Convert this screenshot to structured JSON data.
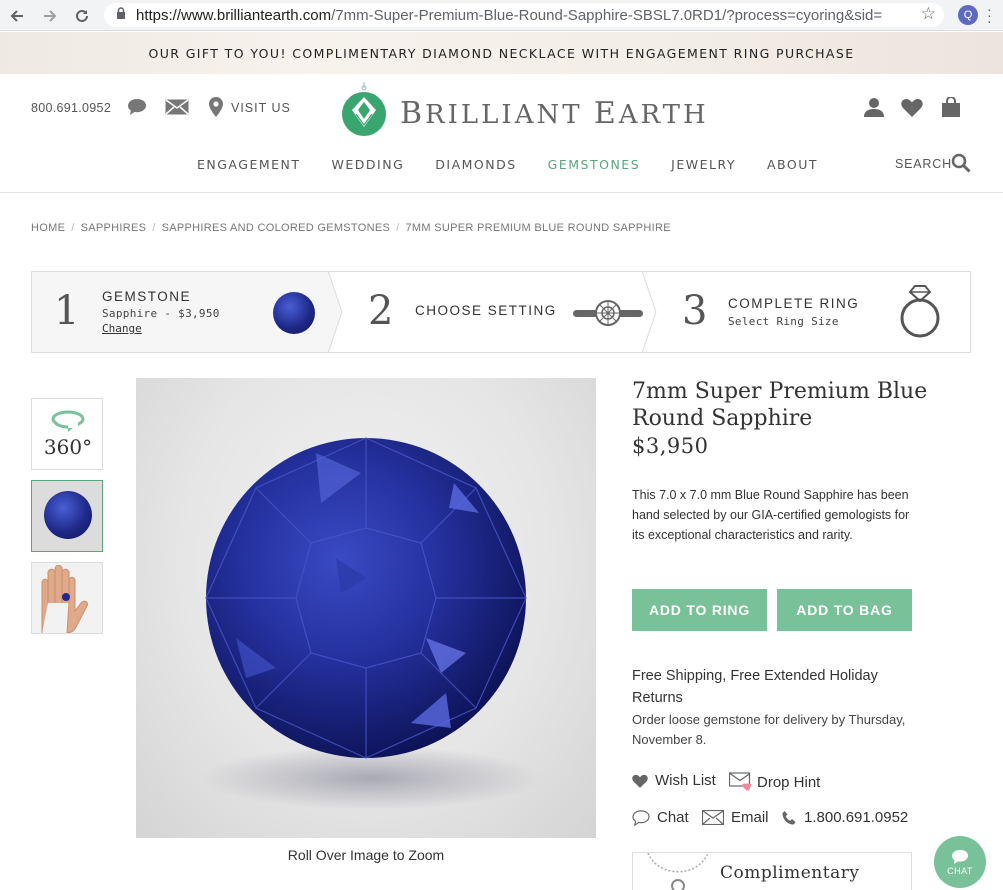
{
  "browser": {
    "url_host": "https://www.brilliantearth.com",
    "url_path": "/7mm-Super-Premium-Blue-Round-Sapphire-SBSL7.0RD1/?process=cyoring&sid=",
    "profile_initial": "Q"
  },
  "promo_banner": "OUR GIFT TO YOU! COMPLIMENTARY DIAMOND NECKLACE WITH ENGAGEMENT RING PURCHASE",
  "header": {
    "phone": "800.691.0952",
    "visit_label": "VISIT US",
    "logo_word1_initial": "B",
    "logo_word1_rest": "RILLIANT",
    "logo_word2_initial": "E",
    "logo_word2_rest": "ARTH",
    "search_label": "SEARCH"
  },
  "nav": {
    "items": [
      "ENGAGEMENT",
      "WEDDING",
      "DIAMONDS",
      "GEMSTONES",
      "JEWELRY",
      "ABOUT"
    ],
    "active": "GEMSTONES"
  },
  "breadcrumb": [
    "HOME",
    "SAPPHIRES",
    "SAPPHIRES AND COLORED GEMSTONES",
    "7MM SUPER PREMIUM BLUE ROUND SAPPHIRE"
  ],
  "steps": [
    {
      "num": "1",
      "title": "GEMSTONE",
      "sub": "Sapphire - $3,950",
      "link": "Change"
    },
    {
      "num": "2",
      "title": "CHOOSE SETTING"
    },
    {
      "num": "3",
      "title": "COMPLETE RING",
      "sub": "Select Ring Size"
    }
  ],
  "thumbs": {
    "view360_label": "360°"
  },
  "product": {
    "title": "7mm Super Premium Blue Round Sapphire",
    "price": "$3,950",
    "description": "This 7.0 x 7.0 mm Blue Round Sapphire has been hand selected by our GIA-certified gemologists for its exceptional characteristics and rarity.",
    "add_to_ring": "ADD TO RING",
    "add_to_bag": "ADD TO BAG",
    "shipping_title": "Free Shipping, Free Extended Holiday Returns",
    "shipping_sub": "Order loose gemstone for delivery by Thursday, November 8.",
    "wish_list": "Wish List",
    "drop_hint": "Drop Hint",
    "chat": "Chat",
    "email": "Email",
    "phone": "1.800.691.0952",
    "promo_box_title": "Complimentary"
  },
  "zoom_hint": "Roll Over Image to Zoom",
  "chat_widget_label": "CHAT",
  "colors": {
    "accent": "#78c199",
    "nav_active": "#5aa67c",
    "sapphire": "#1f2a8a"
  }
}
